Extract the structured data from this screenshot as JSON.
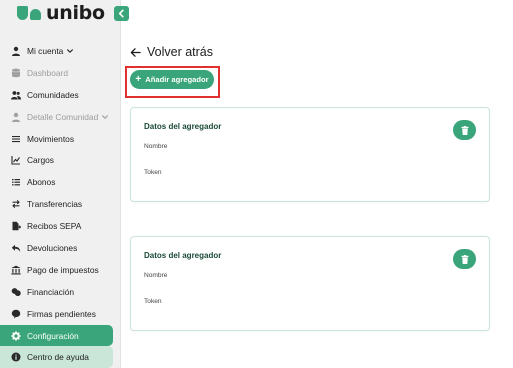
{
  "brand": {
    "name": "unibo",
    "color": "#3aa57a"
  },
  "sidebar": {
    "items": [
      {
        "label": "Mi cuenta",
        "icon": "user-icon",
        "state": "normal",
        "chevron": true
      },
      {
        "label": "Dashboard",
        "icon": "database-icon",
        "state": "disabled",
        "chevron": false
      },
      {
        "label": "Comunidades",
        "icon": "users-icon",
        "state": "normal",
        "chevron": false
      },
      {
        "label": "Detalle Comunidad",
        "icon": "user-icon",
        "state": "disabled",
        "chevron": true
      },
      {
        "label": "Movimientos",
        "icon": "list-icon",
        "state": "normal",
        "chevron": false
      },
      {
        "label": "Cargos",
        "icon": "chart-icon",
        "state": "normal",
        "chevron": false
      },
      {
        "label": "Abonos",
        "icon": "list-check-icon",
        "state": "normal",
        "chevron": false
      },
      {
        "label": "Transferencias",
        "icon": "swap-icon",
        "state": "normal",
        "chevron": false
      },
      {
        "label": "Recibos SEPA",
        "icon": "document-arrow-icon",
        "state": "normal",
        "chevron": false
      },
      {
        "label": "Devoluciones",
        "icon": "reply-icon",
        "state": "normal",
        "chevron": false
      },
      {
        "label": "Pago de impuestos",
        "icon": "bank-icon",
        "state": "normal",
        "chevron": false
      },
      {
        "label": "Financiación",
        "icon": "coins-icon",
        "state": "normal",
        "chevron": false
      },
      {
        "label": "Firmas pendientes",
        "icon": "signature-icon",
        "state": "normal",
        "chevron": false
      },
      {
        "label": "Configuración",
        "icon": "gear-icon",
        "state": "active",
        "chevron": false
      },
      {
        "label": "Centro de ayuda",
        "icon": "info-icon",
        "state": "help",
        "chevron": false
      }
    ]
  },
  "main": {
    "back_label": "Volver atrás",
    "add_button_label": "Añadir agregador",
    "cards": [
      {
        "title": "Datos del agregador",
        "name_label": "Nombre",
        "token_label": "Token"
      },
      {
        "title": "Datos del agregador",
        "name_label": "Nombre",
        "token_label": "Token"
      }
    ]
  }
}
